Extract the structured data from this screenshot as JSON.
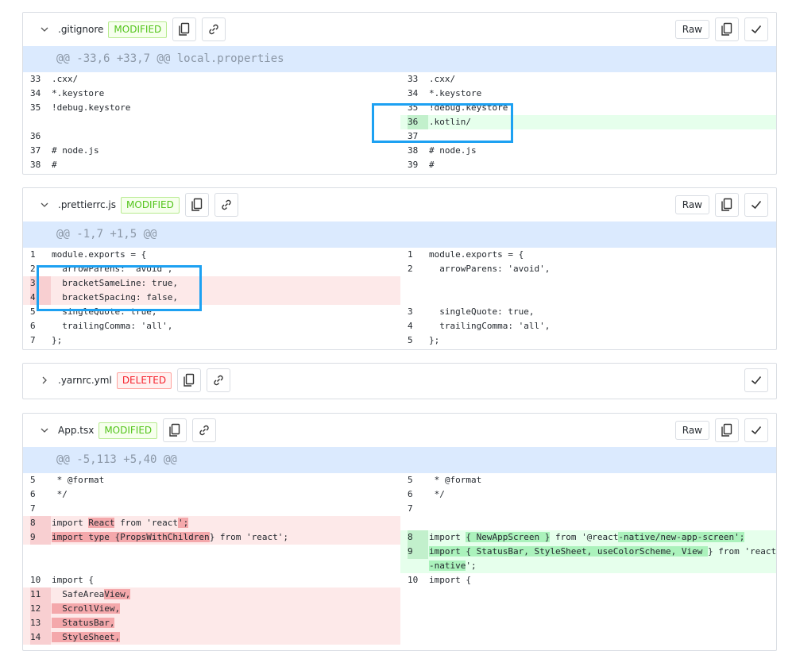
{
  "common": {
    "raw_label": "Raw"
  },
  "files": [
    {
      "name": ".gitignore",
      "status": "MODIFIED",
      "hunk": "@@ -33,6 +33,7 @@ local.properties",
      "left": [
        {
          "n": "33",
          "t": ".cxx/"
        },
        {
          "n": "34",
          "t": "*.keystore"
        },
        {
          "n": "35",
          "t": "!debug.keystore"
        },
        {
          "n": "",
          "t": ""
        },
        {
          "n": "36",
          "t": ""
        },
        {
          "n": "37",
          "t": "# node.js"
        },
        {
          "n": "38",
          "t": "#"
        }
      ],
      "right": [
        {
          "n": "33",
          "t": ".cxx/"
        },
        {
          "n": "34",
          "t": "*.keystore"
        },
        {
          "n": "35",
          "t": "!debug.keystore"
        },
        {
          "n": "36",
          "t": ".kotlin/",
          "type": "add"
        },
        {
          "n": "37",
          "t": ""
        },
        {
          "n": "38",
          "t": "# node.js"
        },
        {
          "n": "39",
          "t": "#"
        }
      ]
    },
    {
      "name": ".prettierrc.js",
      "status": "MODIFIED",
      "hunk": "@@ -1,7 +1,5 @@",
      "left": [
        {
          "n": "1",
          "t": "module.exports = {"
        },
        {
          "n": "2",
          "t": "  arrowParens: 'avoid',"
        },
        {
          "n": "3",
          "t": "  bracketSameLine: true,",
          "type": "del"
        },
        {
          "n": "4",
          "t": "  bracketSpacing: false,",
          "type": "del"
        },
        {
          "n": "5",
          "t": "  singleQuote: true,"
        },
        {
          "n": "6",
          "t": "  trailingComma: 'all',"
        },
        {
          "n": "7",
          "t": "};"
        }
      ],
      "right": [
        {
          "n": "1",
          "t": "module.exports = {"
        },
        {
          "n": "2",
          "t": "  arrowParens: 'avoid',"
        },
        {
          "n": "",
          "t": ""
        },
        {
          "n": "",
          "t": ""
        },
        {
          "n": "3",
          "t": "  singleQuote: true,"
        },
        {
          "n": "4",
          "t": "  trailingComma: 'all',"
        },
        {
          "n": "5",
          "t": "};"
        }
      ]
    },
    {
      "name": ".yarnrc.yml",
      "status": "DELETED"
    },
    {
      "name": "App.tsx",
      "status": "MODIFIED",
      "hunk": "@@ -5,113 +5,40 @@",
      "left": [
        {
          "n": "5",
          "t": " * @format"
        },
        {
          "n": "6",
          "t": " */"
        },
        {
          "n": "7",
          "t": ""
        },
        {
          "n": "8",
          "type": "del",
          "segs": [
            {
              "t": "import "
            },
            {
              "t": "React",
              "h": 1
            },
            {
              "t": " from 'react"
            },
            {
              "t": "';",
              "h": 1
            }
          ]
        },
        {
          "n": "9",
          "type": "del",
          "segs": [
            {
              "t": "import type {PropsWithChildren",
              "h": 1
            },
            {
              "t": "} from 'react';"
            }
          ]
        },
        {
          "n": "",
          "t": ""
        },
        {
          "n": "",
          "t": ""
        },
        {
          "n": "10",
          "t": "import {"
        },
        {
          "n": "11",
          "type": "del",
          "segs": [
            {
              "t": "  SafeArea"
            },
            {
              "t": "View,",
              "h": 1
            }
          ]
        },
        {
          "n": "12",
          "type": "del",
          "segs": [
            {
              "t": "  ScrollView,",
              "h": 1
            }
          ]
        },
        {
          "n": "13",
          "type": "del",
          "segs": [
            {
              "t": "  StatusBar,",
              "h": 1
            }
          ]
        },
        {
          "n": "14",
          "type": "del",
          "segs": [
            {
              "t": "  StyleSheet,",
              "h": 1
            }
          ]
        }
      ],
      "right": [
        {
          "n": "5",
          "t": " * @format"
        },
        {
          "n": "6",
          "t": " */"
        },
        {
          "n": "7",
          "t": ""
        },
        {
          "n": "",
          "t": ""
        },
        {
          "n": "8",
          "type": "add",
          "segs": [
            {
              "t": "import "
            },
            {
              "t": "{ NewAppScreen }",
              "h": 1
            },
            {
              "t": " from '@react"
            },
            {
              "t": "-native/new-app-screen';",
              "h": 1
            }
          ]
        },
        {
          "n": "9",
          "type": "add",
          "segs": [
            {
              "t": "import { StatusBar, StyleSheet, useColorScheme, View ",
              "h": 1
            },
            {
              "t": "} from 'react"
            }
          ]
        },
        {
          "n": "",
          "type": "addcont",
          "segs": [
            {
              "t": "-native",
              "h": 1
            },
            {
              "t": "';"
            }
          ]
        },
        {
          "n": "10",
          "t": "import {"
        }
      ]
    }
  ]
}
